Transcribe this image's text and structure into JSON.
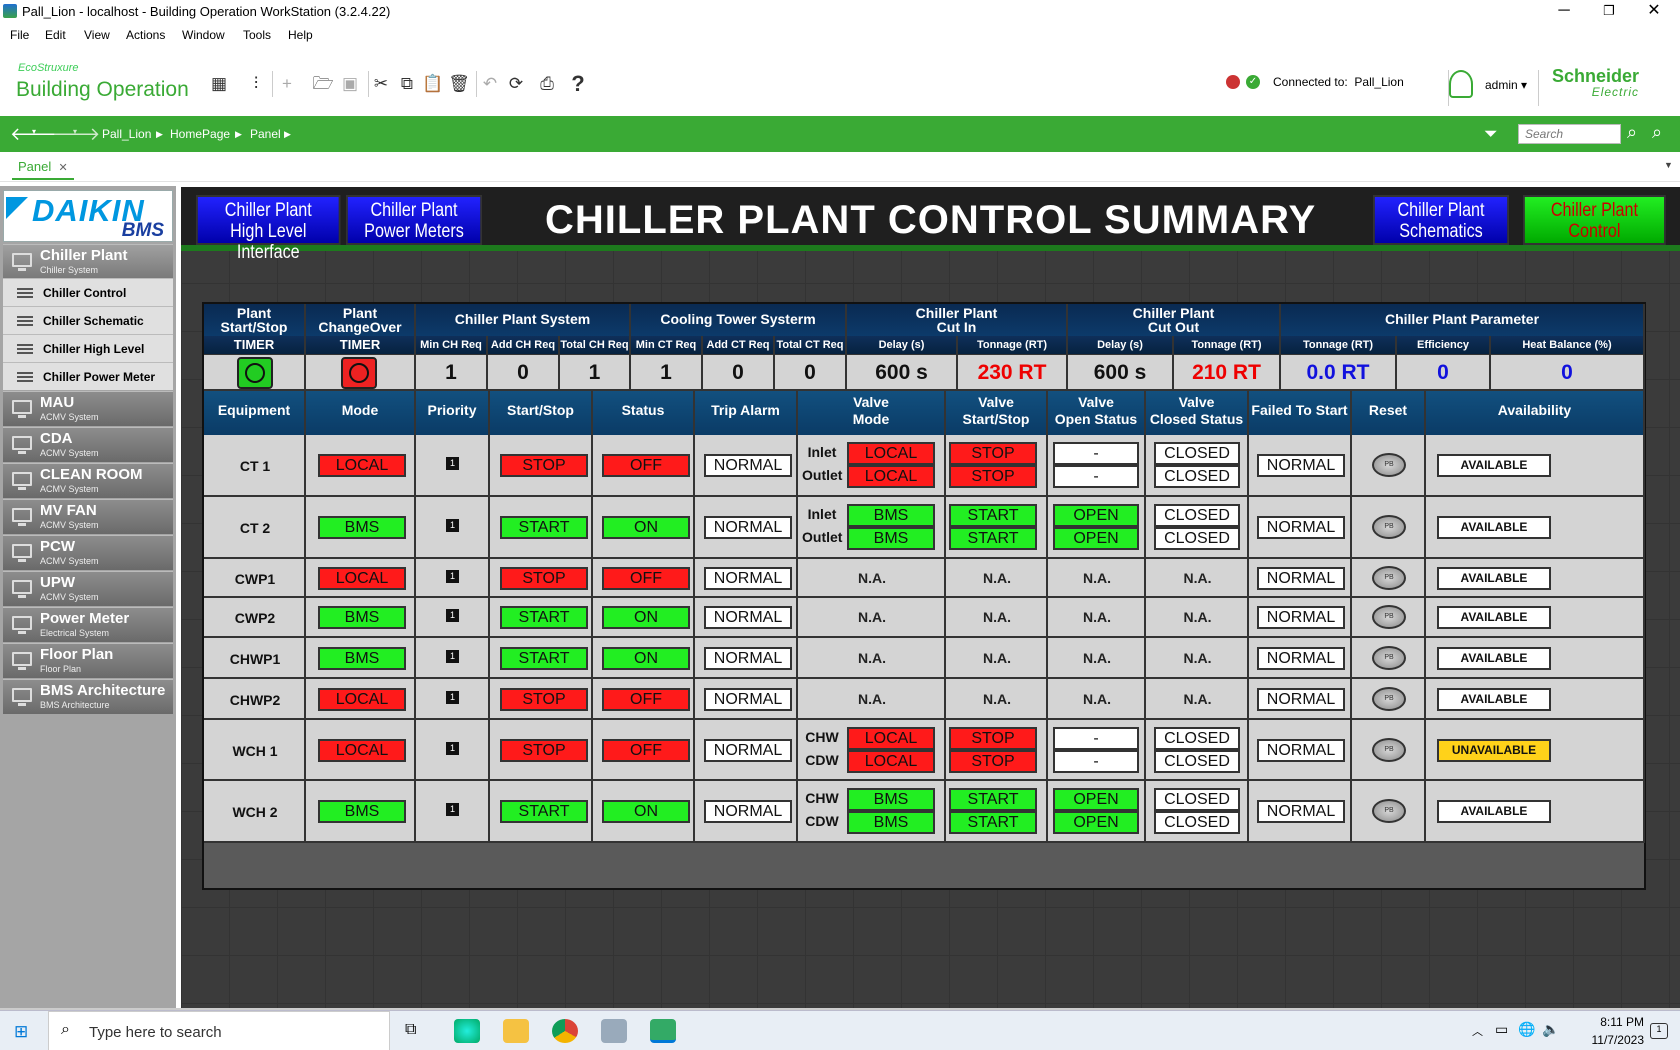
{
  "window": {
    "title": "Pall_Lion - localhost - Building Operation WorkStation (3.2.4.22)"
  },
  "menu": [
    "File",
    "Edit",
    "View",
    "Actions",
    "Window",
    "Tools",
    "Help"
  ],
  "brand": {
    "small": "EcoStruxure",
    "large": "Building Operation",
    "vendor": "Schneider",
    "vendor_sub": "Electric"
  },
  "status": {
    "connected_label": "Connected to:",
    "connected_value": "Pall_Lion",
    "user": "admin"
  },
  "breadcrumb": [
    "Pall_Lion",
    "HomePage",
    "Panel"
  ],
  "search": {
    "placeholder": "Search"
  },
  "tab": {
    "label": "Panel"
  },
  "sidebar": {
    "logo": {
      "line1": "DAIKIN",
      "line2": "BMS"
    },
    "items": [
      {
        "label": "Chiller Plant",
        "sub": "Chiller System"
      },
      {
        "label": "MAU",
        "sub": "ACMV System"
      },
      {
        "label": "CDA",
        "sub": "ACMV System"
      },
      {
        "label": "CLEAN ROOM",
        "sub": "ACMV System"
      },
      {
        "label": "MV FAN",
        "sub": "ACMV System"
      },
      {
        "label": "PCW",
        "sub": "ACMV System"
      },
      {
        "label": "UPW",
        "sub": "ACMV System"
      },
      {
        "label": "Power Meter",
        "sub": "Electrical System"
      },
      {
        "label": "Floor Plan",
        "sub": "Floor Plan"
      },
      {
        "label": "BMS Architecture",
        "sub": "BMS Architecture"
      }
    ],
    "subitems": [
      "Chiller Control",
      "Chiller Schematic",
      "Chiller High Level",
      "Chiller Power Meter"
    ]
  },
  "header": {
    "title": "CHILLER PLANT CONTROL SUMMARY",
    "btn_hli": [
      "Chiller Plant",
      "High Level Interface"
    ],
    "btn_pm": [
      "Chiller Plant",
      "Power Meters"
    ],
    "btn_sch": [
      "Chiller Plant",
      "Schematics"
    ],
    "btn_ctl": [
      "Chiller Plant",
      "Control"
    ]
  },
  "summary": {
    "groups": {
      "start_stop": [
        "Plant",
        "Start/Stop"
      ],
      "changeover": [
        "Plant",
        "ChangeOver"
      ],
      "system": "Chiller Plant System",
      "tower": "Cooling Tower Systerm",
      "cut_in": [
        "Chiller Plant",
        "Cut In"
      ],
      "cut_out": [
        "Chiller Plant",
        "Cut Out"
      ],
      "param": "Chiller Plant Parameter"
    },
    "sub": {
      "timer1": "TIMER",
      "timer2": "TIMER",
      "min_ch": "Min CH Req",
      "add_ch": "Add CH Req",
      "total_ch": "Total CH Req",
      "min_ct": "Min CT Req",
      "add_ct": "Add CT Req",
      "total_ct": "Total CT Req",
      "delay_in": "Delay (s)",
      "ton_in": "Tonnage (RT)",
      "delay_out": "Delay (s)",
      "ton_out": "Tonnage (RT)",
      "ton_p": "Tonnage (RT)",
      "eff": "Efficiency",
      "hb": "Heat Balance (%)"
    },
    "values": {
      "min_ch": "1",
      "add_ch": "0",
      "total_ch": "1",
      "min_ct": "1",
      "add_ct": "0",
      "total_ct": "0",
      "delay_in": "600 s",
      "ton_in": "230 RT",
      "delay_out": "600 s",
      "ton_out": "210 RT",
      "ton_p": "0.0 RT",
      "eff": "0",
      "hb": "0"
    }
  },
  "equipment_table": {
    "headers": {
      "equipment": "Equipment",
      "mode": "Mode",
      "priority": "Priority",
      "startstop": "Start/Stop",
      "status": "Status",
      "trip": "Trip Alarm",
      "vmode": [
        "Valve",
        "Mode"
      ],
      "vss": [
        "Valve",
        "Start/Stop"
      ],
      "vopen": [
        "Valve",
        "Open Status"
      ],
      "vclosed": [
        "Valve",
        "Closed Status"
      ],
      "failed": "Failed To Start",
      "reset": "Reset",
      "avail": "Availability"
    },
    "rows": [
      {
        "name": "CT 1",
        "mode": "LOCAL",
        "priority": "1",
        "startstop": "STOP",
        "status": "OFF",
        "trip": "NORMAL",
        "valves": [
          {
            "label": "Inlet",
            "mode": "LOCAL",
            "ss": "STOP",
            "open": "-",
            "closed": "CLOSED"
          },
          {
            "label": "Outlet",
            "mode": "LOCAL",
            "ss": "STOP",
            "open": "-",
            "closed": "CLOSED"
          }
        ],
        "failed": "NORMAL",
        "reset": "PB",
        "avail": "AVAILABLE"
      },
      {
        "name": "CT 2",
        "mode": "BMS",
        "priority": "1",
        "startstop": "START",
        "status": "ON",
        "trip": "NORMAL",
        "valves": [
          {
            "label": "Inlet",
            "mode": "BMS",
            "ss": "START",
            "open": "OPEN",
            "closed": "CLOSED"
          },
          {
            "label": "Outlet",
            "mode": "BMS",
            "ss": "START",
            "open": "OPEN",
            "closed": "CLOSED"
          }
        ],
        "failed": "NORMAL",
        "reset": "PB",
        "avail": "AVAILABLE"
      },
      {
        "name": "CWP1",
        "mode": "LOCAL",
        "priority": "1",
        "startstop": "STOP",
        "status": "OFF",
        "trip": "NORMAL",
        "na": "N.A.",
        "failed": "NORMAL",
        "reset": "PB",
        "avail": "AVAILABLE"
      },
      {
        "name": "CWP2",
        "mode": "BMS",
        "priority": "1",
        "startstop": "START",
        "status": "ON",
        "trip": "NORMAL",
        "na": "N.A.",
        "failed": "NORMAL",
        "reset": "PB",
        "avail": "AVAILABLE"
      },
      {
        "name": "CHWP1",
        "mode": "BMS",
        "priority": "1",
        "startstop": "START",
        "status": "ON",
        "trip": "NORMAL",
        "na": "N.A.",
        "failed": "NORMAL",
        "reset": "PB",
        "avail": "AVAILABLE"
      },
      {
        "name": "CHWP2",
        "mode": "LOCAL",
        "priority": "1",
        "startstop": "STOP",
        "status": "OFF",
        "trip": "NORMAL",
        "na": "N.A.",
        "failed": "NORMAL",
        "reset": "PB",
        "avail": "AVAILABLE"
      },
      {
        "name": "WCH 1",
        "mode": "LOCAL",
        "priority": "1",
        "startstop": "STOP",
        "status": "OFF",
        "trip": "NORMAL",
        "valves": [
          {
            "label": "CHW",
            "mode": "LOCAL",
            "ss": "STOP",
            "open": "-",
            "closed": "CLOSED"
          },
          {
            "label": "CDW",
            "mode": "LOCAL",
            "ss": "STOP",
            "open": "-",
            "closed": "CLOSED"
          }
        ],
        "failed": "NORMAL",
        "reset": "PB",
        "avail": "UNAVAILABLE"
      },
      {
        "name": "WCH 2",
        "mode": "BMS",
        "priority": "1",
        "startstop": "START",
        "status": "ON",
        "trip": "NORMAL",
        "valves": [
          {
            "label": "CHW",
            "mode": "BMS",
            "ss": "START",
            "open": "OPEN",
            "closed": "CLOSED"
          },
          {
            "label": "CDW",
            "mode": "BMS",
            "ss": "START",
            "open": "OPEN",
            "closed": "CLOSED"
          }
        ],
        "failed": "NORMAL",
        "reset": "PB",
        "avail": "AVAILABLE"
      }
    ]
  },
  "colors": {
    "red": "#ff1a1a",
    "green": "#22ee22",
    "white": "#ffffff",
    "yellow": "#ffd21a",
    "brand_green": "#3aaa35"
  },
  "taskbar": {
    "search_placeholder": "Type here to search",
    "time": "8:11 PM",
    "date": "11/7/2023"
  }
}
